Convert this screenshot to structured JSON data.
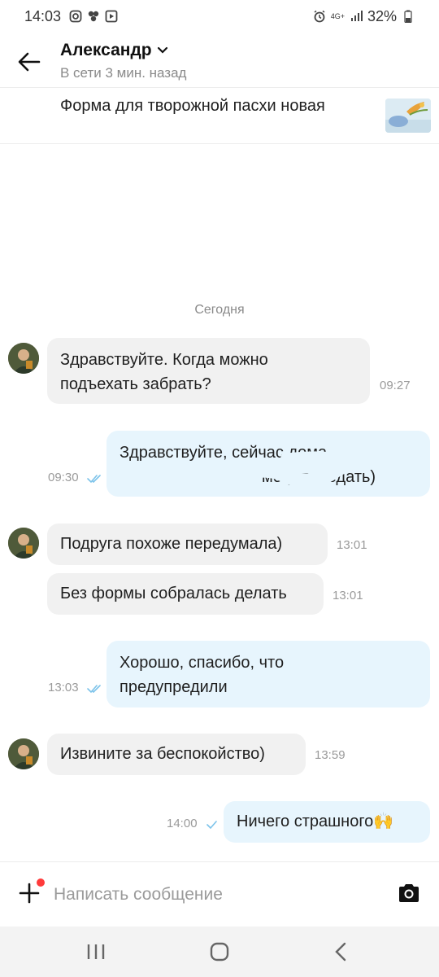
{
  "status_bar": {
    "time": "14:03",
    "network": "4G+",
    "battery": "32%"
  },
  "header": {
    "name": "Александр",
    "status": "В сети 3 мин. назад"
  },
  "listing": {
    "title": "Форма для творожной пасхи новая"
  },
  "chat": {
    "date_separator": "Сегодня",
    "messages": [
      {
        "direction": "in",
        "line1": "Здравствуйте. Когда можно",
        "line2": "подъехать забрать?",
        "time": "09:27"
      },
      {
        "direction": "out",
        "line1": "Здравствуйте,  сейчас дома,",
        "line2": "могу передать)",
        "time": "09:30",
        "status": "read"
      },
      {
        "direction": "in",
        "text": "Подруга похоже передумала)",
        "time": "13:01"
      },
      {
        "direction": "in",
        "text": "Без формы собралась делать",
        "time": "13:01"
      },
      {
        "direction": "out",
        "line1": "Хорошо,  спасибо,  что",
        "line2": "предупредили",
        "time": "13:03",
        "status": "read"
      },
      {
        "direction": "in",
        "text": "Извините за беспокойство)",
        "time": "13:59"
      },
      {
        "direction": "out",
        "text": "Ничего страшного🙌",
        "time": "14:00",
        "status": "sent"
      }
    ]
  },
  "composer": {
    "placeholder": "Написать сообщение"
  },
  "colors": {
    "incoming_bubble": "#f1f1f1",
    "outgoing_bubble": "#e7f5fd",
    "check_blue": "#7cc3ea",
    "badge_red": "#ff3b3b"
  },
  "icons": [
    "back-arrow-icon",
    "chevron-down-icon",
    "plus-icon",
    "camera-icon",
    "recents-icon",
    "home-icon",
    "back-nav-icon"
  ]
}
